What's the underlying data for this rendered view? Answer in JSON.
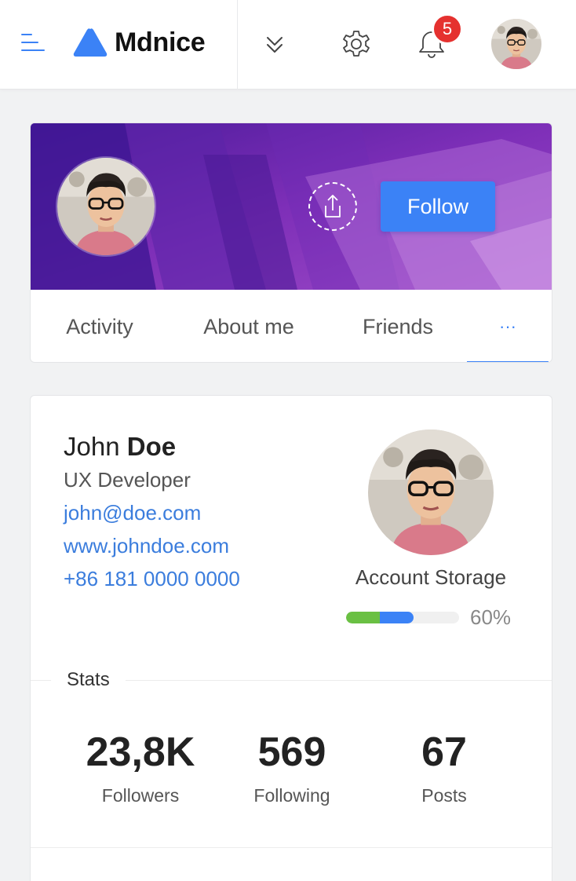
{
  "header": {
    "brand": "Mdnice",
    "notification_count": "5",
    "colors": {
      "accent": "#3b82f6",
      "badge": "#e5312f"
    }
  },
  "profile": {
    "follow_label": "Follow",
    "tabs": [
      {
        "label": "Activity"
      },
      {
        "label": "About me"
      },
      {
        "label": "Friends"
      },
      {
        "label": "···"
      }
    ],
    "active_tab": 3,
    "cover_colors": [
      "#4a1a9a",
      "#7b2fbe",
      "#a45bd6"
    ]
  },
  "user": {
    "first_name": "John",
    "last_name": "Doe",
    "role": "UX Developer",
    "email": "john@doe.com",
    "website": "www.johndoe.com",
    "phone": "+86 181 0000 0000"
  },
  "storage": {
    "label": "Account Storage",
    "percent_label": "60%",
    "green_fraction": 0.3,
    "blue_fraction": 0.3
  },
  "stats": {
    "title": "Stats",
    "items": [
      {
        "value": "23,8K",
        "label": "Followers"
      },
      {
        "value": "569",
        "label": "Following"
      },
      {
        "value": "67",
        "label": "Posts"
      }
    ]
  }
}
